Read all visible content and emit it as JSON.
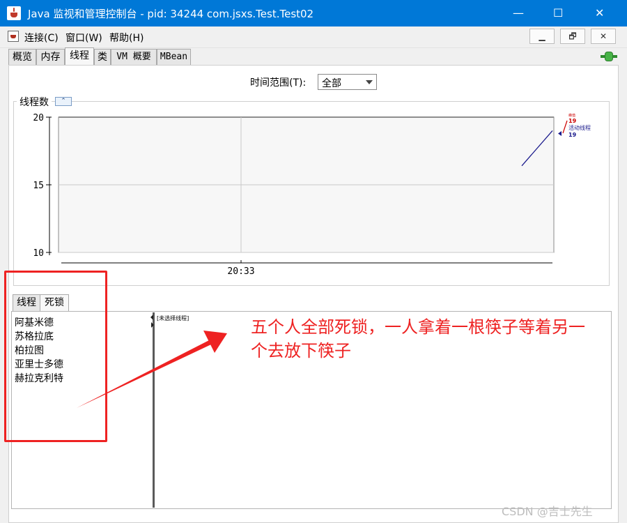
{
  "window": {
    "title": "Java 监视和管理控制台 - pid: 34244 com.jsxs.Test.Test02",
    "min_glyph": "—",
    "max_glyph": "☐",
    "close_glyph": "✕"
  },
  "menubar": {
    "items": [
      "连接(C)",
      "窗口(W)",
      "帮助(H)"
    ],
    "mdi_buttons": [
      "▁",
      "🗗",
      "✕"
    ]
  },
  "tabs": [
    "概览",
    "内存",
    "线程",
    "类",
    "VM 概要",
    "MBean"
  ],
  "active_tab": "线程",
  "time_range": {
    "label": "时间范围(T):",
    "value": "全部"
  },
  "chart_panel": {
    "title": "线程数",
    "collapse_icon": "⌃"
  },
  "chart_data": {
    "type": "line",
    "x": [
      "20:33"
    ],
    "ylim": [
      10,
      20
    ],
    "yticks": [
      "20",
      "15",
      "10"
    ],
    "xticks": [
      "20:33"
    ],
    "grid": true,
    "series": [
      {
        "name": "活动线程",
        "values": [
          19
        ],
        "color": "#1a1a8c"
      }
    ],
    "legend": {
      "position": "right",
      "peak_label": "峰值",
      "peak_value": "19",
      "peak_color": "#cc0000",
      "active_label": "活动线程",
      "active_value": "19",
      "active_color": "#1a1a8c"
    }
  },
  "subtabs": [
    "线程",
    "死锁"
  ],
  "active_subtab": "死锁",
  "deadlock_threads": [
    "阿基米德",
    "苏格拉底",
    "柏拉图",
    "亚里士多德",
    "赫拉克利特"
  ],
  "detail_placeholder": "[未选择线程]",
  "annotation": "五个人全部死锁，一人拿着一根筷子等着另一个去放下筷子",
  "watermark": "CSDN @吉士先生",
  "colors": {
    "titlebar": "#0078d7",
    "annotation": "#ee2222",
    "peak": "#cc0000",
    "active": "#1a1a8c"
  }
}
